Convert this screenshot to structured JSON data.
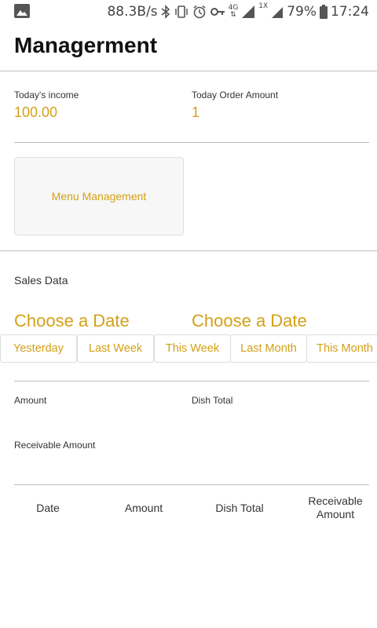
{
  "status_bar": {
    "image_icon": "image-icon",
    "net_speed": "88.3B/s",
    "network_type": "4G",
    "sim_label": "1X",
    "battery_percent": "79%",
    "time": "17:24"
  },
  "header": {
    "title": "Managerment"
  },
  "summary": {
    "income_label": "Today's income",
    "income_value": "100.00",
    "order_label": "Today Order Amount",
    "order_value": "1"
  },
  "menu_management": {
    "label": "Menu Management"
  },
  "sales": {
    "title": "Sales Data",
    "start_date": "Choose a Date",
    "end_date": "Choose a Date",
    "ranges": [
      "Yesterday",
      "Last Week",
      "This Week",
      "Last Month",
      "This Month"
    ],
    "amount_label": "Amount",
    "dish_total_label": "Dish Total",
    "receivable_label": "Receivable Amount"
  },
  "table": {
    "columns": [
      "Date",
      "Amount",
      "Dish Total",
      "Receivable\nAmount"
    ]
  },
  "colors": {
    "accent": "#d4a017",
    "divider": "#bdbdbd"
  }
}
